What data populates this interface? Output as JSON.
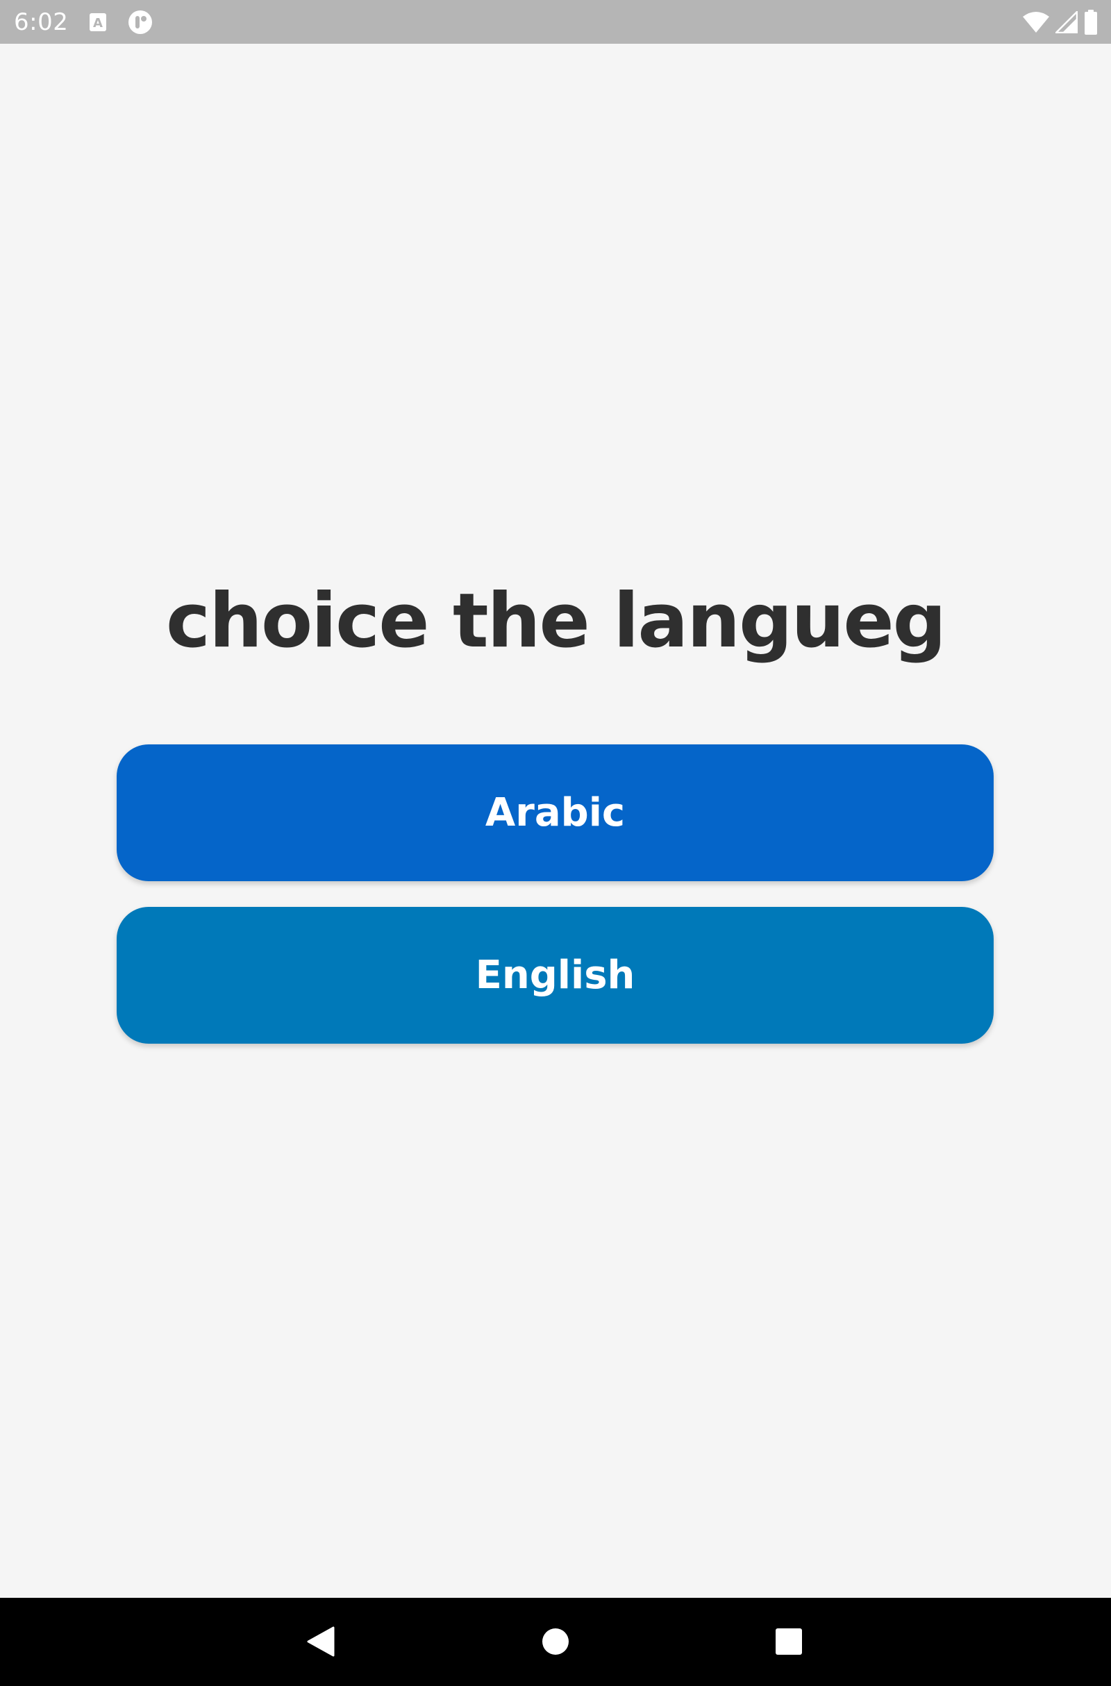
{
  "status_bar": {
    "time": "6:02",
    "left_icons": [
      "text-a-icon",
      "app-notification-icon"
    ],
    "right_icons": [
      "wifi-icon",
      "cell-signal-icon",
      "battery-icon"
    ]
  },
  "main": {
    "title": "choice the langueg",
    "buttons": [
      {
        "label": "Arabic",
        "color": "#0565c9"
      },
      {
        "label": "English",
        "color": "#0079b9"
      }
    ]
  },
  "nav_bar": {
    "buttons": [
      "back-icon",
      "home-icon",
      "recent-apps-icon"
    ]
  },
  "colors": {
    "background": "#f5f5f5",
    "status_bar": "#b5b5b5",
    "title_text": "#2f2f2f",
    "nav_bar": "#000000"
  }
}
